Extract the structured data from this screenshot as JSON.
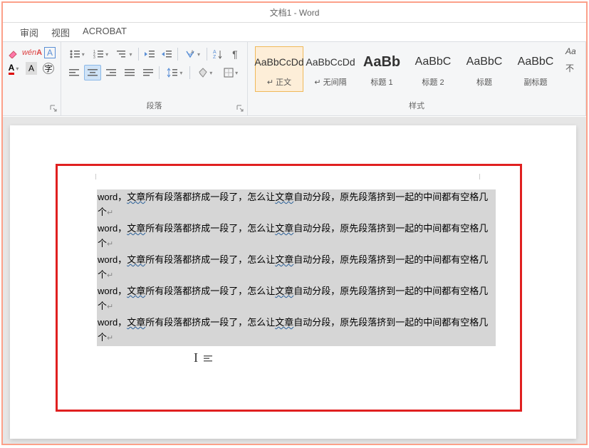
{
  "title": "文档1 - Word",
  "tabs": {
    "review": "审阅",
    "view": "视图",
    "acrobat": "ACROBAT"
  },
  "paragraph_group": "段落",
  "styles_group": "样式",
  "styles": [
    {
      "sample": "AaBbCcDd",
      "name": "↵ 正文",
      "cls": ""
    },
    {
      "sample": "AaBbCcDd",
      "name": "↵ 无间隔",
      "cls": ""
    },
    {
      "sample": "AaBb",
      "name": "标题 1",
      "cls": "big"
    },
    {
      "sample": "AaBbC",
      "name": "标题 2",
      "cls": "med"
    },
    {
      "sample": "AaBbC",
      "name": "标题",
      "cls": "med"
    },
    {
      "sample": "AaBbC",
      "name": "副标题",
      "cls": "med"
    }
  ],
  "trunc": {
    "a": "Aa",
    "b": "不"
  },
  "body_text": "word，文章所有段落都挤成一段了，怎么让文章自动分段，原先段落挤到一起的中间都有空格几个",
  "wavy_segment": "文章",
  "pilcrow": "↵"
}
